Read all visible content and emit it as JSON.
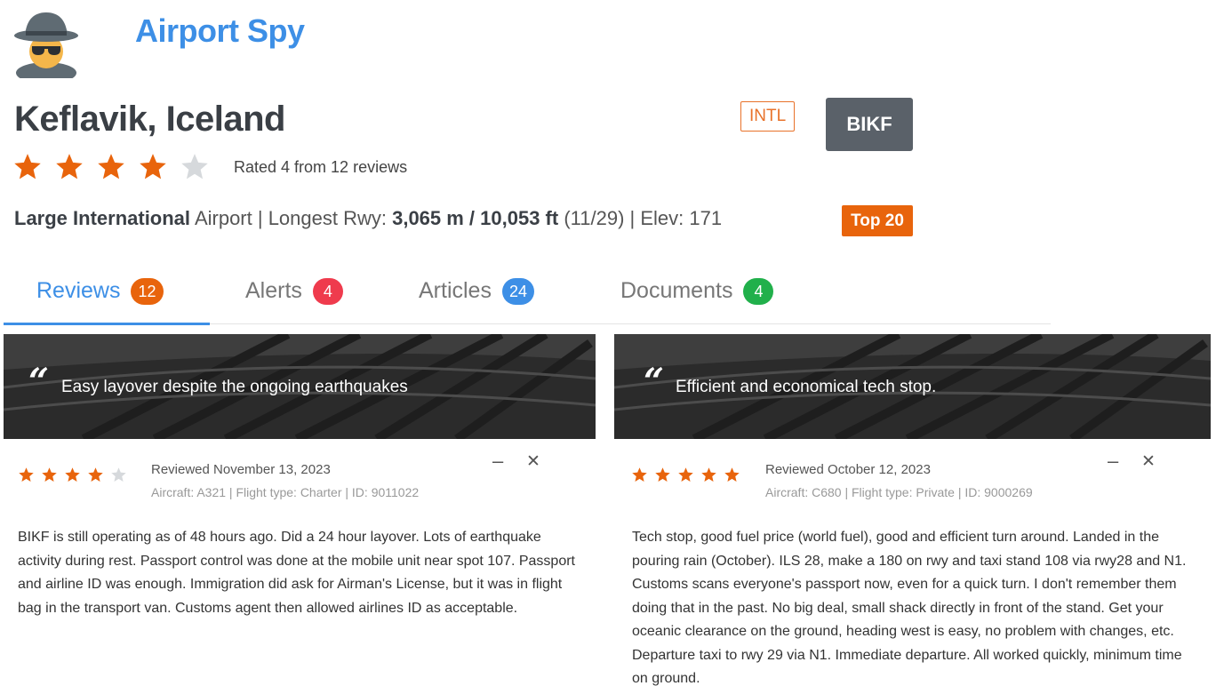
{
  "header": {
    "brand": "Airport Spy",
    "logo_icon": "spy-avatar-icon"
  },
  "airport": {
    "name": "Keflavik, Iceland",
    "type_badge": "INTL",
    "icao": "BIKF",
    "rating": 4,
    "rating_max": 5,
    "rating_text": "Rated 4 from 12 reviews",
    "size": "Large International",
    "airport_word": "Airport",
    "rwy_prefix": " | Longest Rwy: ",
    "longest_rwy": "3,065 m / 10,053 ft",
    "rwy_designation": " (11/29) | Elev: 171",
    "rank_badge": "Top 20"
  },
  "tabs": [
    {
      "label": "Reviews",
      "count": "12",
      "color": "#e8640c",
      "active": true
    },
    {
      "label": "Alerts",
      "count": "4",
      "color": "#ef3b4d",
      "active": false
    },
    {
      "label": "Articles",
      "count": "24",
      "color": "#3d8fe6",
      "active": false
    },
    {
      "label": "Documents",
      "count": "4",
      "color": "#21b04b",
      "active": false
    }
  ],
  "colors": {
    "accent": "#3d8fe6",
    "star": "#e8640c",
    "star_empty": "#d6d9dc"
  },
  "reviews": [
    {
      "title": "Easy layover despite the ongoing earthquakes",
      "rating": 4,
      "date": "Reviewed November 13, 2023",
      "meta": "Aircraft: A321 | Flight type: Charter | ID: 9011022",
      "minimize": "–",
      "close": "✕",
      "body": "BIKF is still operating as of 48 hours ago. Did a 24 hour layover. Lots of earthquake activity during rest. Passport control was done at the mobile unit near spot 107. Passport and airline ID was enough. Immigration did ask for Airman's License, but it was in flight bag in the transport van. Customs agent then allowed airlines ID as acceptable."
    },
    {
      "title": "Efficient and economical tech stop.",
      "rating": 5,
      "date": "Reviewed October 12, 2023",
      "meta": "Aircraft: C680 | Flight type: Private | ID: 9000269",
      "minimize": "–",
      "close": "✕",
      "body": "Tech stop, good fuel price (world fuel), good and efficient turn around. Landed in the pouring rain (October). ILS 28, make a 180 on rwy and taxi stand 108 via rwy28 and N1. Customs scans everyone's passport now, even for a quick turn. I don't remember them doing that in the past. No big deal, small shack directly in front of the stand. Get your oceanic clearance on the ground, heading west is easy, no problem with changes, etc. Departure taxi to rwy 29 via N1. Immediate departure. All worked quickly, minimum time on ground."
    }
  ]
}
